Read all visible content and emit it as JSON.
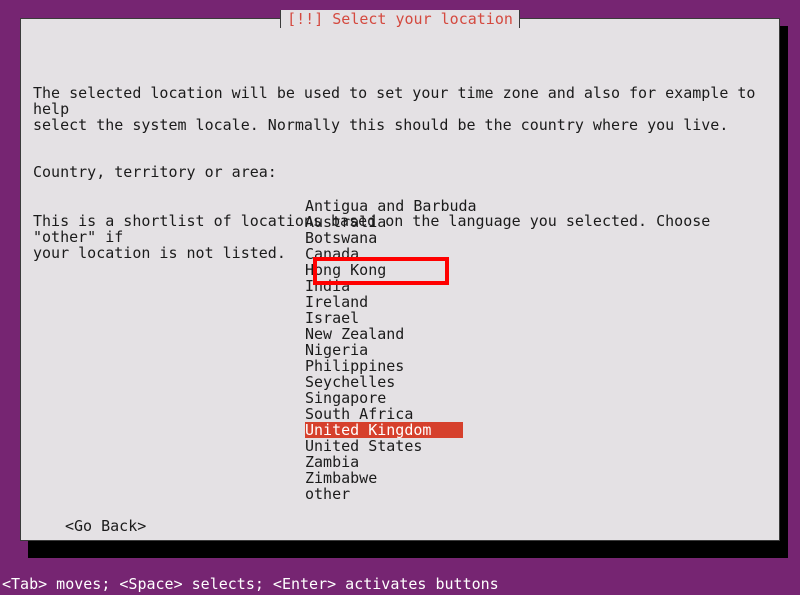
{
  "screen": {
    "background_color": "#762572",
    "dialog_background_color": "#e4e1e4",
    "accent_color": "#d4493f",
    "selection_background_color": "#d6402c",
    "selection_text_color": "#ffffff",
    "annotation_color": "#ff0000"
  },
  "dialog": {
    "title": "[!!] Select your location",
    "paragraph_1": "The selected location will be used to set your time zone and also for example to help\nselect the system locale. Normally this should be the country where you live.",
    "paragraph_2": "This is a shortlist of locations based on the language you selected. Choose \"other\" if\nyour location is not listed.",
    "field_label": "Country, territory or area:",
    "go_back_label": "<Go Back>"
  },
  "country_list": {
    "selected_index": 14,
    "annotated_index": 4,
    "items": [
      {
        "label": "Antigua and Barbuda"
      },
      {
        "label": "Australia"
      },
      {
        "label": "Botswana"
      },
      {
        "label": "Canada"
      },
      {
        "label": "Hong Kong"
      },
      {
        "label": "India"
      },
      {
        "label": "Ireland"
      },
      {
        "label": "Israel"
      },
      {
        "label": "New Zealand"
      },
      {
        "label": "Nigeria"
      },
      {
        "label": "Philippines"
      },
      {
        "label": "Seychelles"
      },
      {
        "label": "Singapore"
      },
      {
        "label": "South Africa"
      },
      {
        "label": "United Kingdom"
      },
      {
        "label": "United States"
      },
      {
        "label": "Zambia"
      },
      {
        "label": "Zimbabwe"
      },
      {
        "label": "other"
      }
    ]
  },
  "status_bar": {
    "text": "<Tab> moves; <Space> selects; <Enter> activates buttons"
  }
}
